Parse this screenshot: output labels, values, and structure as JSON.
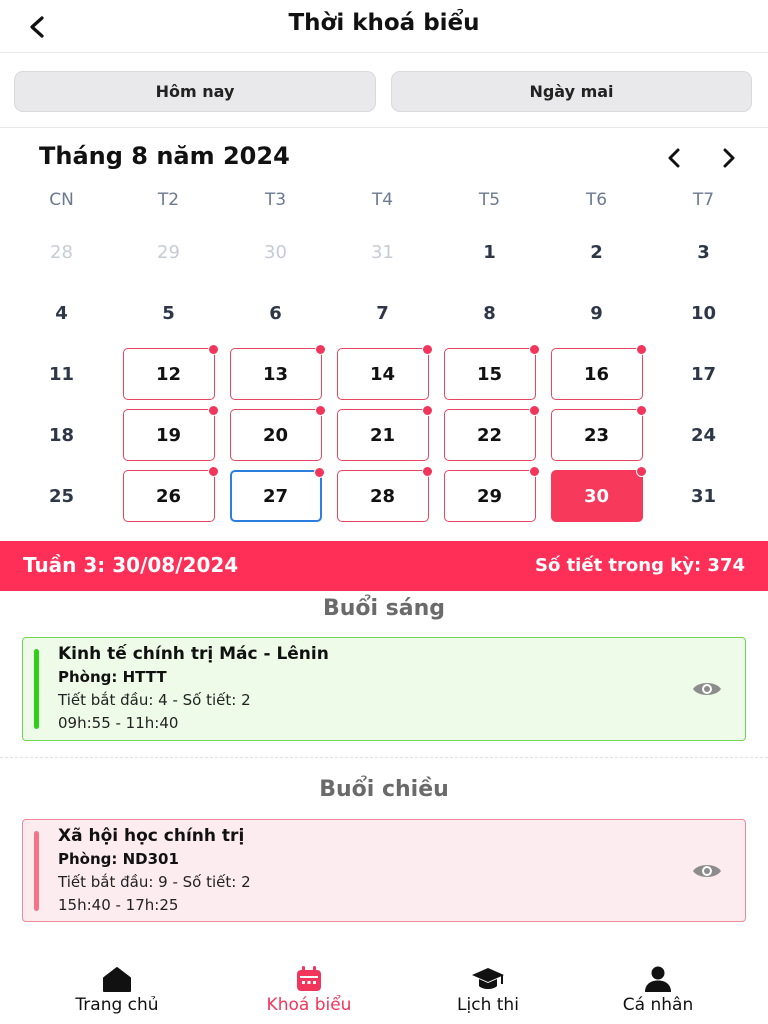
{
  "header": {
    "title": "Thời khoá biểu"
  },
  "quick": {
    "today": "Hôm nay",
    "tomorrow": "Ngày mai"
  },
  "calendar": {
    "month_title": "Tháng 8 năm 2024",
    "weekdays": [
      "CN",
      "T2",
      "T3",
      "T4",
      "T5",
      "T6",
      "T7"
    ],
    "weeks": [
      [
        {
          "d": "28",
          "s": "muted"
        },
        {
          "d": "29",
          "s": "muted"
        },
        {
          "d": "30",
          "s": "muted"
        },
        {
          "d": "31",
          "s": "muted"
        },
        {
          "d": "1",
          "s": ""
        },
        {
          "d": "2",
          "s": ""
        },
        {
          "d": "3",
          "s": ""
        }
      ],
      [
        {
          "d": "4",
          "s": ""
        },
        {
          "d": "5",
          "s": ""
        },
        {
          "d": "6",
          "s": ""
        },
        {
          "d": "7",
          "s": ""
        },
        {
          "d": "8",
          "s": ""
        },
        {
          "d": "9",
          "s": ""
        },
        {
          "d": "10",
          "s": ""
        }
      ],
      [
        {
          "d": "11",
          "s": ""
        },
        {
          "d": "12",
          "s": "sched"
        },
        {
          "d": "13",
          "s": "sched"
        },
        {
          "d": "14",
          "s": "sched"
        },
        {
          "d": "15",
          "s": "sched"
        },
        {
          "d": "16",
          "s": "sched"
        },
        {
          "d": "17",
          "s": ""
        }
      ],
      [
        {
          "d": "18",
          "s": ""
        },
        {
          "d": "19",
          "s": "sched"
        },
        {
          "d": "20",
          "s": "sched"
        },
        {
          "d": "21",
          "s": "sched"
        },
        {
          "d": "22",
          "s": "sched"
        },
        {
          "d": "23",
          "s": "sched"
        },
        {
          "d": "24",
          "s": ""
        }
      ],
      [
        {
          "d": "25",
          "s": ""
        },
        {
          "d": "26",
          "s": "sched"
        },
        {
          "d": "27",
          "s": "today"
        },
        {
          "d": "28",
          "s": "sched"
        },
        {
          "d": "29",
          "s": "sched"
        },
        {
          "d": "30",
          "s": "selected"
        },
        {
          "d": "31",
          "s": ""
        }
      ]
    ]
  },
  "week_bar": {
    "week": "Tuần 3: 30/08/2024",
    "term": "Số tiết trong kỳ: 374"
  },
  "morning": {
    "title": "Buổi sáng",
    "subject": "Kinh tế chính trị Mác - Lênin",
    "room": "Phòng: HTTT",
    "period": "Tiết bắt đầu: 4 - Số tiết: 2",
    "time": "09h:55 - 11h:40"
  },
  "afternoon": {
    "title": "Buổi chiều",
    "subject": "Xã hội học chính trị",
    "room": "Phòng: ND301",
    "period": "Tiết bắt đầu: 9 - Số tiết: 2",
    "time": "15h:40 - 17h:25"
  },
  "nav": {
    "home": "Trang chủ",
    "schedule": "Khoá biểu",
    "exams": "Lịch thi",
    "profile": "Cá nhân"
  },
  "colors": {
    "accent": "#ff2f57",
    "today_border": "#2d7ee0",
    "morning": "#2fcf16",
    "afternoon": "#f47486"
  },
  "icons": [
    "back-icon",
    "chevron-left-icon",
    "chevron-right-icon",
    "eye-icon",
    "home-icon",
    "calendar-icon",
    "graduation-cap-icon",
    "user-icon"
  ]
}
